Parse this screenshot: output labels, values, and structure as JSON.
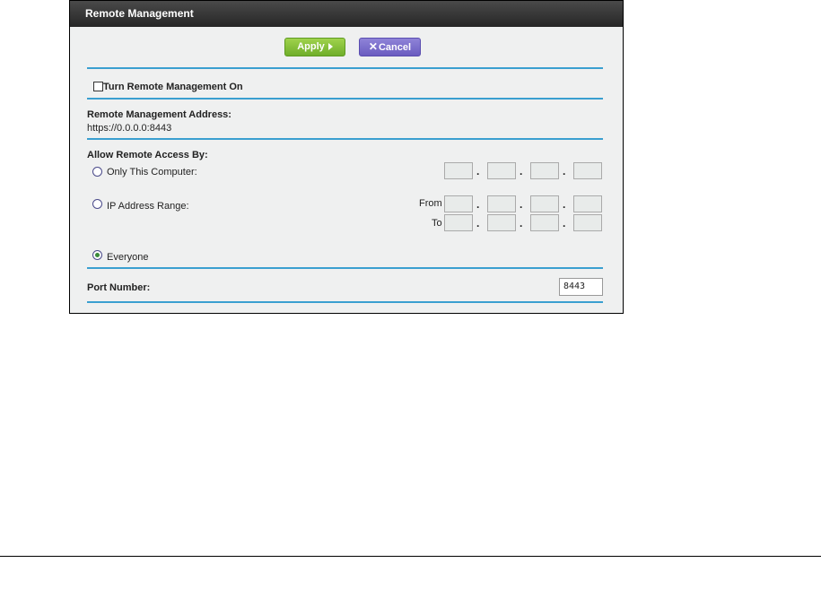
{
  "panel": {
    "title": "Remote Management",
    "apply_label": "Apply",
    "cancel_label": "Cancel",
    "turn_on_label": "Turn Remote Management On",
    "turn_on_checked": false,
    "address_heading": "Remote Management Address:",
    "address_value": "https://0.0.0.0:8443",
    "allow_heading": "Allow Remote Access By:",
    "options": {
      "only_this_computer": "Only This Computer:",
      "ip_address_range": "IP Address Range:",
      "everyone": "Everyone"
    },
    "selected_option": "everyone",
    "from_label": "From",
    "to_label": "To",
    "ip_separator": ".",
    "port_label": "Port Number:",
    "port_value": "8443"
  },
  "colors": {
    "accent_line": "#3a9fd0",
    "apply_green": "#84c13a",
    "cancel_purple": "#7b6fcd",
    "titlebar": "#333333"
  },
  "icons": {
    "apply": "play-triangle-icon",
    "cancel": "x-icon"
  }
}
